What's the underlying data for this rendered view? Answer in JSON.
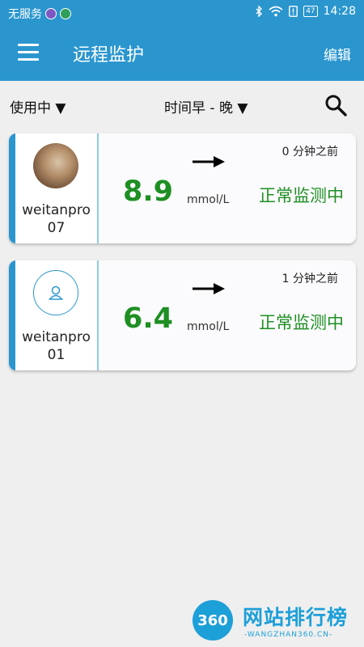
{
  "status_bar": {
    "carrier": "无服务",
    "battery": "47",
    "time": "14:28"
  },
  "app_bar": {
    "title": "远程监护",
    "edit_label": "编辑"
  },
  "filters": {
    "status_label": "使用中 ▼",
    "time_label": "时间早 - 晚 ▼"
  },
  "cards": [
    {
      "username": "weitanpro07",
      "value": "8.9",
      "unit": "mmol/L",
      "time_ago": "0 分钟之前",
      "status": "正常监测中"
    },
    {
      "username": "weitanpro01",
      "value": "6.4",
      "unit": "mmol/L",
      "time_ago": "1 分钟之前",
      "status": "正常监测中"
    }
  ],
  "watermark": {
    "logo_text": "360",
    "text": "网站排行榜",
    "sub": "-WANGZHAN360.CN-"
  },
  "colors": {
    "primary": "#2b96ce",
    "value_green": "#1e8f22",
    "background": "#efefef"
  }
}
